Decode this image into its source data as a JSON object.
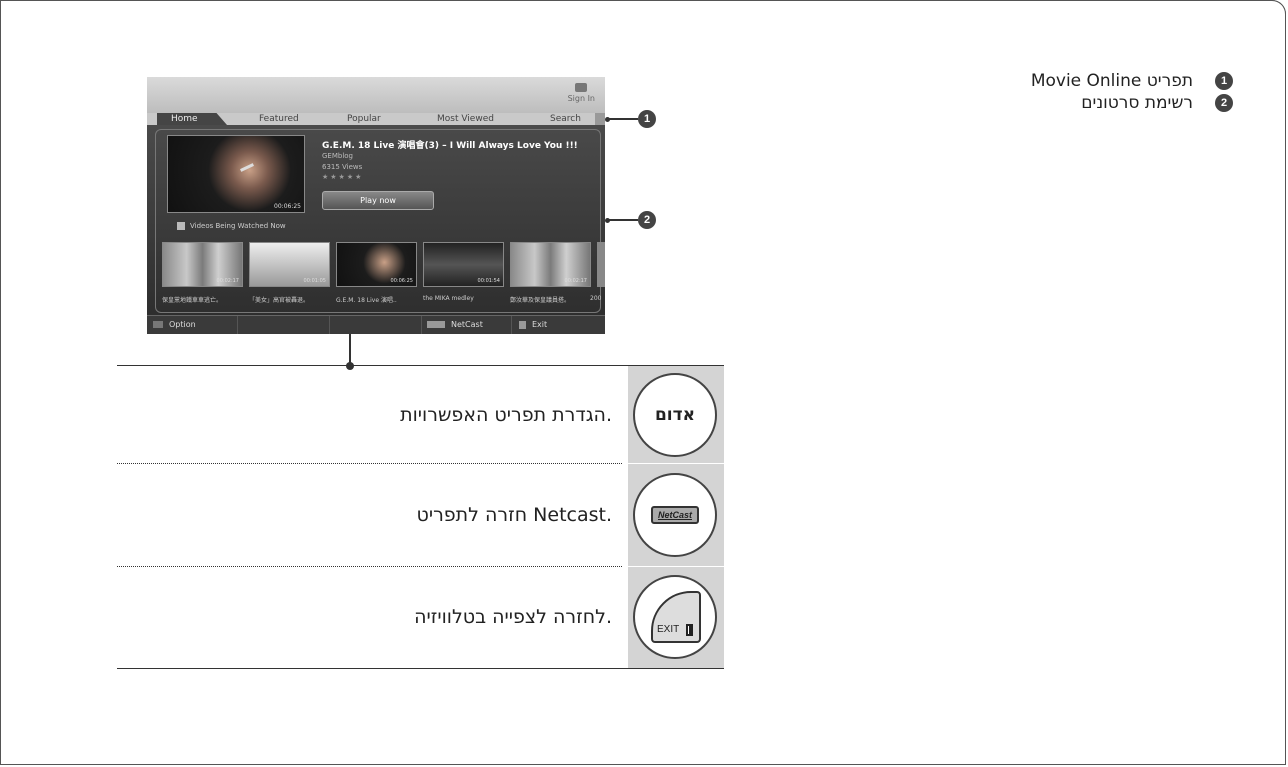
{
  "tv_screen": {
    "sign_in": "Sign In",
    "tabs": [
      "Home",
      "Featured",
      "Popular",
      "Most Viewed",
      "Search"
    ],
    "featured": {
      "title": "G.E.M. 18 Live 演唱會(3) – I Will Always Love You !!!",
      "blog": "GEMblog",
      "views": "6315 Views",
      "stars": "★★★★★",
      "duration": "00:06:25",
      "play_label": "Play now"
    },
    "section_label": "Videos Being Watched Now",
    "thumbnails": [
      {
        "time": "00:02:17",
        "caption": "保皇黨地鐵車車逃亡。"
      },
      {
        "time": "00:01:05",
        "caption": "「美女」高官被轟退。"
      },
      {
        "time": "00:06:25",
        "caption": "G.E.M. 18 Live 演唱.."
      },
      {
        "time": "00:01:54",
        "caption": "the MIKA medley"
      },
      {
        "time": "00:02:17",
        "caption": "鄭汝華及保皇議員搭。"
      },
      {
        "time": "",
        "caption": "200"
      }
    ],
    "bottom_bar": {
      "option": "Option",
      "netcast": "NetCast",
      "exit": "Exit"
    }
  },
  "callouts": [
    "1",
    "2"
  ],
  "rows": [
    {
      "key_label": "אדום",
      "description": "הגדרת תפריט האפשרויות."
    },
    {
      "key_label": "NetCast",
      "description": "חזרה לתפריט Netcast."
    },
    {
      "key_label": "EXIT",
      "description": "לחזרה לצפייה בטלוויזיה."
    }
  ],
  "legend": [
    {
      "num": "1",
      "text": "תפריט Movie Online"
    },
    {
      "num": "2",
      "text": "רשימת סרטונים"
    }
  ]
}
